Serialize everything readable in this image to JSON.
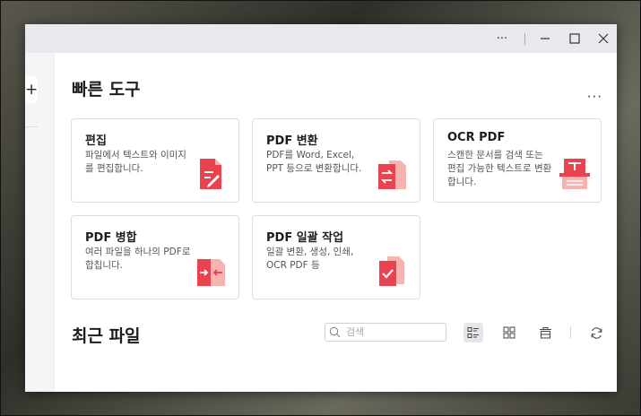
{
  "titlebar": {
    "more_label": "···"
  },
  "sidebar": {
    "add_label": "+"
  },
  "quick_tools": {
    "title": "빠른 도구",
    "more_label": "···",
    "cards": [
      {
        "title": "편집",
        "desc": "파일에서 텍스트와 이미지를 편집합니다.",
        "icon": "edit-doc-icon"
      },
      {
        "title": "PDF 변환",
        "desc": "PDF를 Word, Excel, PPT 등으로 변환합니다.",
        "icon": "convert-doc-icon"
      },
      {
        "title": "OCR PDF",
        "desc": "스캔한 문서를 검색 또는 편집 가능한 텍스트로 변환합니다.",
        "icon": "ocr-scan-icon"
      },
      {
        "title": "PDF 병합",
        "desc": "여러 파일을 하나의 PDF로 합칩니다.",
        "icon": "merge-doc-icon"
      },
      {
        "title": "PDF 일괄 작업",
        "desc": "일괄 변환, 생성, 인쇄, OCR PDF 등",
        "icon": "batch-doc-icon"
      }
    ]
  },
  "recent": {
    "title": "최근 파일",
    "search_placeholder": "검색"
  },
  "colors": {
    "accent": "#e8434f",
    "accent_light": "#f6b3b0"
  }
}
